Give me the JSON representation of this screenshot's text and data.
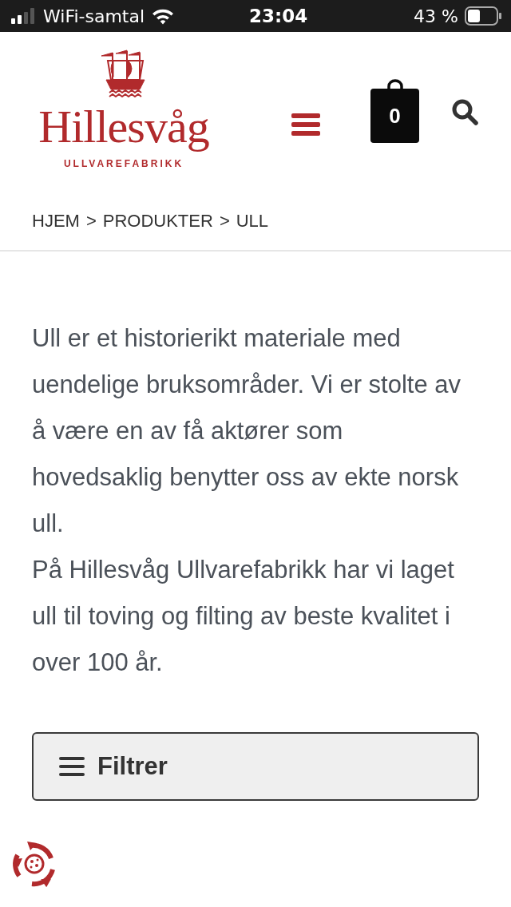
{
  "status_bar": {
    "carrier": "WiFi-samtal",
    "time": "23:04",
    "battery": "43 %"
  },
  "header": {
    "logo_name": "Hillesvåg",
    "logo_subtitle": "ULLVAREFABRIKK",
    "cart_count": "0"
  },
  "breadcrumb": {
    "links": [
      {
        "label": "HJEM",
        "separator": ">"
      },
      {
        "label": "PRODUKTER",
        "separator": ">"
      }
    ],
    "current": "ULL"
  },
  "intro": [
    "Ull er et historierikt materiale med uendelige bruksområder. Vi er stolte av å være en av få aktører som hovedsaklig benytter oss av ekte norsk ull.",
    "På Hillesvåg Ullvarefabrikk har vi laget ull til toving og filting av beste kvalitet i over 100 år."
  ],
  "filter_button": {
    "label": "Filtrer"
  }
}
